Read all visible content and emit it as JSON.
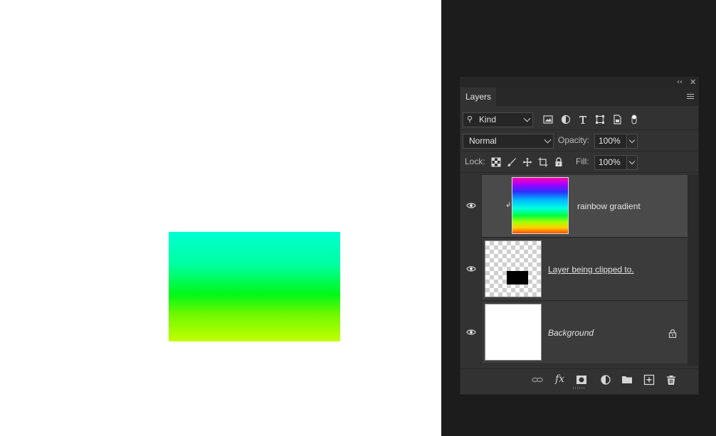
{
  "canvas": {
    "background": "#ffffff",
    "shape_fill": "green-cyan gradient"
  },
  "panel": {
    "tab_label": "Layers",
    "kind_label": "Kind",
    "blend_mode": "Normal",
    "opacity_label": "Opacity:",
    "opacity_value": "100%",
    "lock_label": "Lock:",
    "fill_label": "Fill:",
    "fill_value": "100%"
  },
  "filter_icons": [
    "image-filter-icon",
    "adjustment-filter-icon",
    "type-filter-icon",
    "shape-filter-icon",
    "smart-object-filter-icon",
    "filter-toggle-icon"
  ],
  "lock_icons": [
    "lock-transparent-pixels-icon",
    "lock-image-pixels-icon",
    "lock-position-icon",
    "lock-artboard-icon",
    "lock-all-icon"
  ],
  "layers": [
    {
      "name": "rainbow gradient",
      "visible": true,
      "selected": true,
      "clipped": true
    },
    {
      "name": "Layer being clipped to.",
      "visible": true,
      "selected": false
    },
    {
      "name": "Background",
      "visible": true,
      "selected": false,
      "locked": true
    }
  ],
  "bottom_icons": [
    "link-layers-icon",
    "fx-icon",
    "layer-mask-icon",
    "adjustment-layer-icon",
    "group-folder-icon",
    "new-layer-icon",
    "trash-icon"
  ],
  "colors": {
    "ui_bg": "#1c1c1c",
    "panel_bg": "#323232",
    "selected_row": "#4a4a4a"
  }
}
